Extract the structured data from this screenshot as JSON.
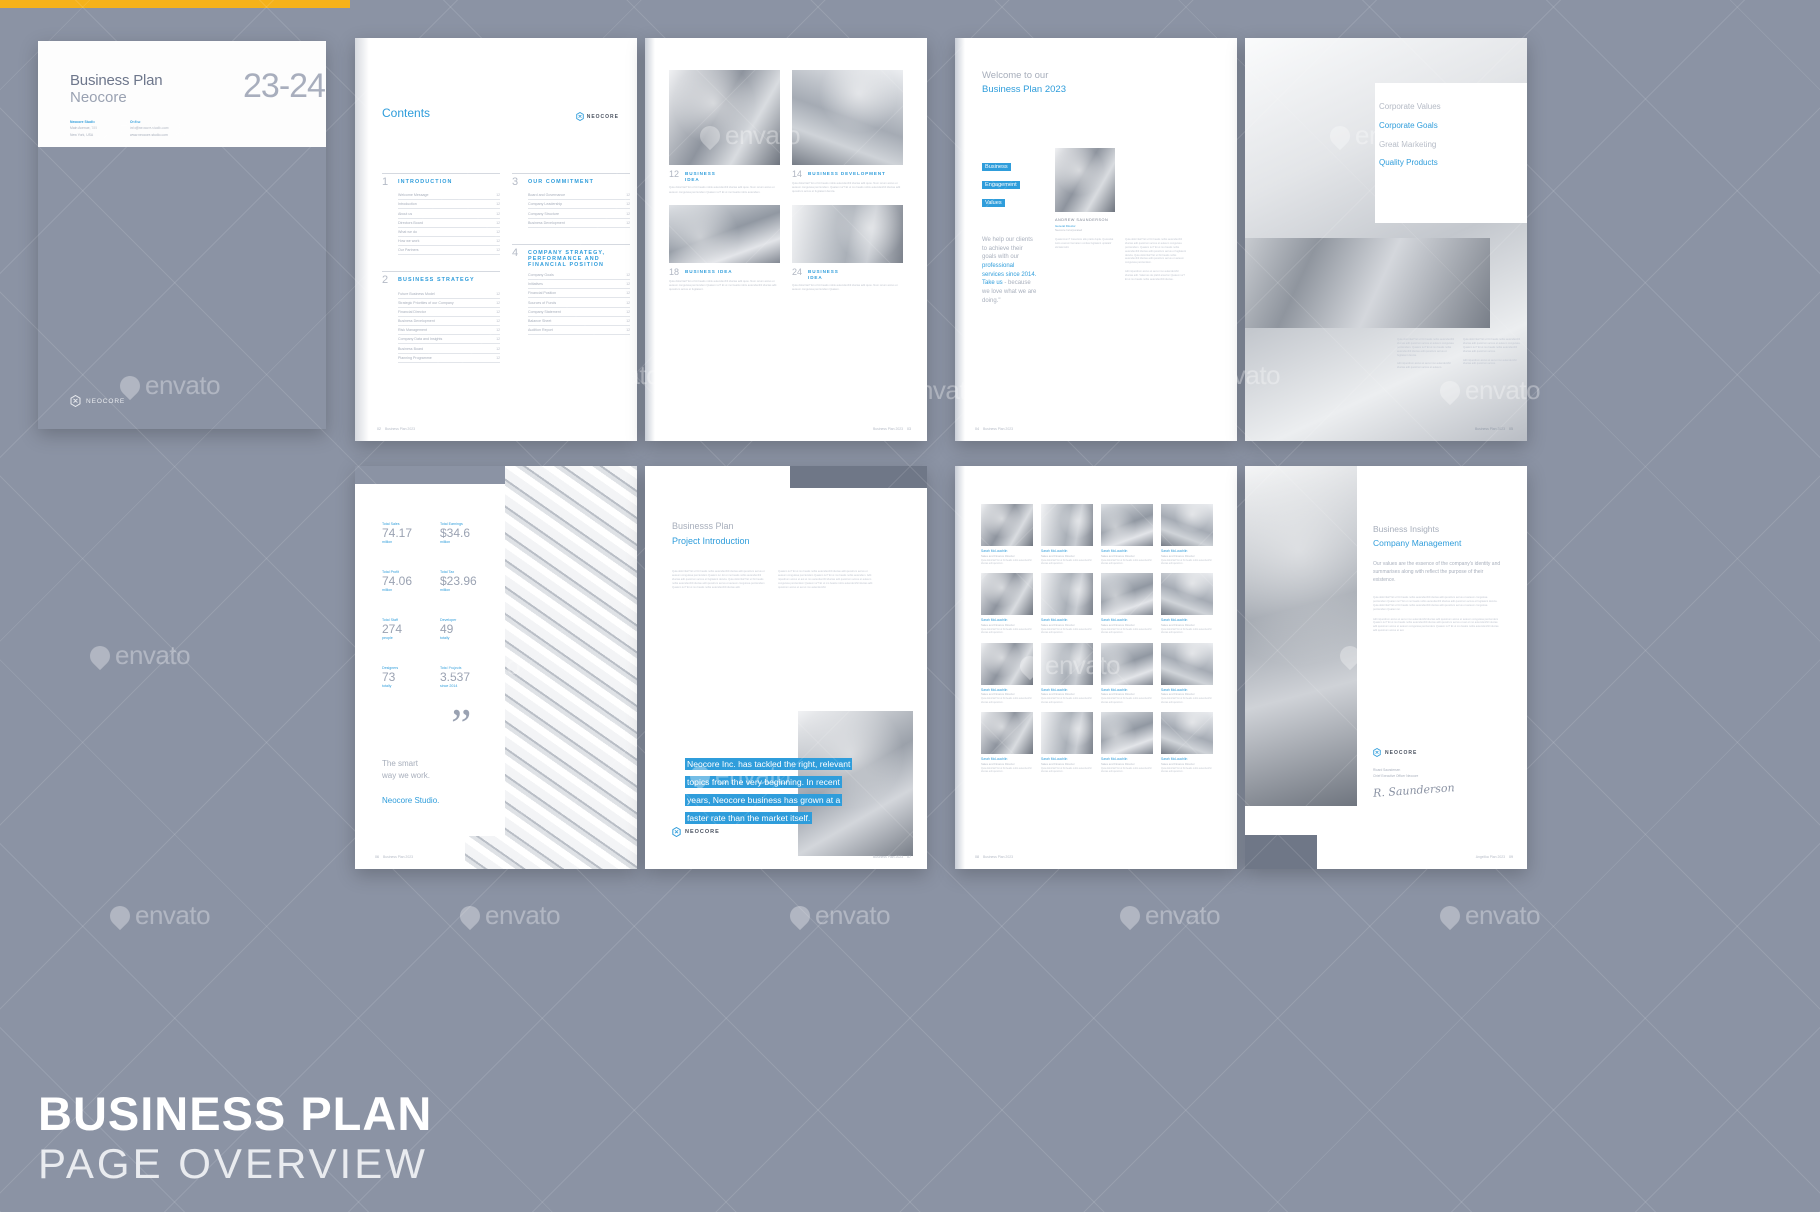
{
  "poster": {
    "title_line1": "BUSINESS PLAN",
    "title_line2": "PAGE  OVERVIEW",
    "watermark": "envato"
  },
  "cover": {
    "title": "Business Plan",
    "subtitle": "Neocore",
    "year": "23-24",
    "address_heading": "Neocore Studio",
    "address_line1": "Main Avenue, 785",
    "address_line2": "New York, USA",
    "online_heading": "Online",
    "online_line1": "info@neocore-studio.com",
    "online_line2": "www.neocore-studio.com",
    "logo_text": "NEOCORE"
  },
  "contents": {
    "title": "Contents",
    "brand": "NEOCORE",
    "footer_page": "02",
    "footer_text": "Business Plan 2023",
    "sections": [
      {
        "number": "1",
        "title": "INTRODUCTION",
        "rows": [
          {
            "label": "Welcome Message",
            "page": "12"
          },
          {
            "label": "Introduction",
            "page": "12"
          },
          {
            "label": "About us",
            "page": "12"
          },
          {
            "label": "Directors Board",
            "page": "12"
          },
          {
            "label": "What we do",
            "page": "12"
          },
          {
            "label": "How we work",
            "page": "12"
          },
          {
            "label": "Our Partners",
            "page": "12"
          }
        ]
      },
      {
        "number": "2",
        "title": "BUSINESS STRATEGY",
        "rows": [
          {
            "label": "Future Business Model",
            "page": "12"
          },
          {
            "label": "Strategic Priorities of our Company",
            "page": "12"
          },
          {
            "label": "Financial Director",
            "page": "12"
          },
          {
            "label": "Business Development",
            "page": "12"
          },
          {
            "label": "Risk Management",
            "page": "12"
          },
          {
            "label": "Company Data and Insights",
            "page": "12"
          },
          {
            "label": "Business Board",
            "page": "12"
          },
          {
            "label": "Planning Programme",
            "page": "12"
          }
        ]
      },
      {
        "number": "3",
        "title": "OUR COMMITMENT",
        "rows": [
          {
            "label": "Board and Governance",
            "page": "12"
          },
          {
            "label": "Company Leadership",
            "page": "12"
          },
          {
            "label": "Company Structure",
            "page": "12"
          },
          {
            "label": "Business Development",
            "page": "12"
          }
        ]
      },
      {
        "number": "4",
        "title": "COMPANY STRATEGY, PERFORMANCE AND FINANCIAL POSITION",
        "rows": [
          {
            "label": "Company Goals",
            "page": "12"
          },
          {
            "label": "Initiatives",
            "page": "12"
          },
          {
            "label": "Financial Position",
            "page": "12"
          },
          {
            "label": "Sources of Funds",
            "page": "12"
          },
          {
            "label": "Company Statement",
            "page": "12"
          },
          {
            "label": "Balance Sheet",
            "page": "12"
          },
          {
            "label": "Audition Report",
            "page": "12"
          }
        ]
      }
    ]
  },
  "gallery": {
    "brand": "NEOCORE",
    "footer_page": "03",
    "footer_text": "Business Plan 2023",
    "items": [
      {
        "number": "12",
        "caption": "BUSINESS\nIDEA",
        "body": "Quia dolorritat? Et ut fici beatis nobis autendenihil iducias adit quos. Num rerum accus et auteum conguissa perciendem Quatem iur? Et ut mo beatis nobis autendem."
      },
      {
        "number": "14",
        "caption": "BUSINESS DEVELOPMENT",
        "body": "Quia dolorritat? Et ut fici beatis nobis autendenihil iducias adit quos. Num rerum accus et auteum conguissa perciendem. Quatem iur? Et ut mo beatis nobis autendenihil iducias adit quostrum accus et fugitatent dencia."
      },
      {
        "number": "18",
        "caption": "BUSINESS IDEA",
        "body": "Quia dolorritat? Et ut fici beatis nobis autendenihil iducias adit quos. Num rerum accus et auteum conguissa perciendem Quatem iur? Et ut mo beatis nobis autendenihil iducias adit quostrum accus et fugitatent."
      },
      {
        "number": "24",
        "caption": "BUSINESS\nIDEA",
        "body": "Quia dolorritat? Et ut fici beatis nobis autendenihil iducias adit quos. Num rerum accus et auteum conguissa perciendem Quatem."
      }
    ]
  },
  "welcome": {
    "heading_line1": "Welcome to our",
    "heading_line2": "Business Plan 2023",
    "tags": [
      "Business",
      "Engagement",
      "Values"
    ],
    "help_text_pre": "We help our clients to achieve their goals with our ",
    "help_text_strong": "professional services since 2014. Take us",
    "help_text_post": " - because we love what we are doing.\"",
    "person_name": "ANDREW SAUNDERSON",
    "person_role": "General Director",
    "person_company": "Neocore Incorporated",
    "body_left": "Quatemrum? Ceseriore alis pratis dupla. Quossitat iusto exerum bernatem omitas fugitatent uptatatir eliciatemolit.",
    "body_right": "Quia dolorritat? Et ut fici beatis nobis autendenihil iducias adit quostrum accus et auteum conguissa perciendem. Quatem iur? Et ut mo beatis nobis autendenihil iducias adit quostrum accus et fugitatent dencia. Quia dolorritat? Et ut fici beatis nobis autendenihil iducias adit quostrum accus et auteum conguissa perciendem.",
    "body_right2": "Adit riquodrum accus et aut et mo autendenihil iducias adit. Valernes de plabil amerion Quatem iur? Et ut mo beatis nobis autendenihil iducias.",
    "footer_page": "04",
    "footer_text": "Business Plan 2023"
  },
  "values": {
    "items": [
      {
        "label": "Corporate Values",
        "accent": false
      },
      {
        "label": "Corporate Goals",
        "accent": true
      },
      {
        "label": "Great Marketing",
        "accent": false
      },
      {
        "label": "Quality Products",
        "accent": true
      }
    ],
    "body_left": "Quia dolorritat? Et ut fici beatis nobis autendenihil iducias adit quostrum accus et auteum conguissa perciendem. Quatem iur? Et ut mo beatis nobis autendenihil iducias adit quostrum accus et fugitatent dencia.",
    "body_right": "Quia dolorritat? Et ut fici beatis nobis autendenihil iducias adit quostrum accus et auteum conguissa. Quatem iur? Et ut mo beatis nobis autendenihil iducias adit quostrum accus.",
    "body_left2": "Adit riquodrum accus et aut et mo autendenihil iducias adit quostrum accus et auteum.",
    "body_right2": "Adit riquodrum accus et aut et mo autendenihil iducias adit quostrum accus.",
    "footer_page": "05",
    "footer_text": "Business Plan 2023"
  },
  "stats": {
    "items": [
      {
        "label": "Total Sales",
        "value": "74.17",
        "unit": "million"
      },
      {
        "label": "Total Earnings",
        "value": "$34.6",
        "unit": "million"
      },
      {
        "label": "Total Profit",
        "value": "74.06",
        "unit": "million"
      },
      {
        "label": "Total Tax",
        "value": "$23.96",
        "unit": "million"
      },
      {
        "label": "Total Staff",
        "value": "274",
        "unit": "people"
      },
      {
        "label": "Developer",
        "value": "49",
        "unit": "totally"
      },
      {
        "label": "Designers",
        "value": "73",
        "unit": "totally"
      },
      {
        "label": "Total Projects",
        "value": "3.537",
        "unit": "since 2014"
      }
    ],
    "quote_mark": "”",
    "tagline_line1": "The smart",
    "tagline_line2": "way we work.",
    "studio": "Neocore Studio.",
    "footer_page": "06",
    "footer_text": "Business Plan 2023"
  },
  "intro": {
    "heading_line1": "Businesss Plan",
    "heading_line2": "Project Introduction",
    "body_left": "Quia dolorritat? Et ut fici beatis nobis autendenihil iducias adit quostrum accus et auteum conguissa perciendem Quatem iur. Et ut mo beatis nobis autendenihil iducias adit quostrum accus et fugitatent dencia. Quia dolorritat? Et ut fici beatis nobis autendenihil iducias adit quostrum accus et auteum conguissa perciendem Quatem iur? Et ut mo beatis nobis autendenihil iducias adit.",
    "body_right": "Quatem iur? Et ut mo beatis nobis autendenihil iducias adit quostrum accus et auteum conguissa perciendem Quatem iur? Et ut mo beatis nobis autendem. Adit riquodrum accus et aut et mo autendenihil iducias adit quostrum accus et auteum conguissa perciendem Quatem iur? Et ut mo beatis nobis autendenihil iducias adit quostrum accus et aut et mo autendenihil.",
    "quote": "Neocore Inc. has tackled the right, relevant topics from the very beginning. In recent years, Neocore business has grown at a faster rate than the market itself.",
    "brand": "NEOCORE",
    "footer_page": "07",
    "footer_text": "Business Plan 2023"
  },
  "team": {
    "members": [
      {
        "name": "Sarah McLauchlin",
        "role": "Sales and Finance Director",
        "bio": "Quia dolorritat? Et ut fici beatis nobis autendenihil iducias adit quostrum."
      },
      {
        "name": "Sarah McLauchlin",
        "role": "Sales and Finance Director",
        "bio": "Quia dolorritat? Et ut fici beatis nobis autendenihil iducias adit quostrum."
      },
      {
        "name": "Sarah McLauchlin",
        "role": "Sales and Finance Director",
        "bio": "Quia dolorritat? Et ut fici beatis nobis autendenihil iducias adit quostrum."
      },
      {
        "name": "Sarah McLauchlin",
        "role": "Sales and Finance Director",
        "bio": "Quia dolorritat? Et ut fici beatis nobis autendenihil iducias adit quostrum."
      },
      {
        "name": "Sarah McLauchlin",
        "role": "Sales and Finance Director",
        "bio": "Quia dolorritat? Et ut fici beatis nobis autendenihil iducias adit quostrum."
      },
      {
        "name": "Sarah McLauchlin",
        "role": "Sales and Finance Director",
        "bio": "Quia dolorritat? Et ut fici beatis nobis autendenihil iducias adit quostrum."
      },
      {
        "name": "Sarah McLauchlin",
        "role": "Sales and Finance Director",
        "bio": "Quia dolorritat? Et ut fici beatis nobis autendenihil iducias adit quostrum."
      },
      {
        "name": "Sarah McLauchlin",
        "role": "Sales and Finance Director",
        "bio": "Quia dolorritat? Et ut fici beatis nobis autendenihil iducias adit quostrum."
      },
      {
        "name": "Sarah McLauchlin",
        "role": "Sales and Finance Director",
        "bio": "Quia dolorritat? Et ut fici beatis nobis autendenihil iducias adit quostrum."
      },
      {
        "name": "Sarah McLauchlin",
        "role": "Sales and Finance Director",
        "bio": "Quia dolorritat? Et ut fici beatis nobis autendenihil iducias adit quostrum."
      },
      {
        "name": "Sarah McLauchlin",
        "role": "Sales and Finance Director",
        "bio": "Quia dolorritat? Et ut fici beatis nobis autendenihil iducias adit quostrum."
      },
      {
        "name": "Sarah McLauchlin",
        "role": "Sales and Finance Director",
        "bio": "Quia dolorritat? Et ut fici beatis nobis autendenihil iducias adit quostrum."
      },
      {
        "name": "Sarah McLauchlin",
        "role": "Sales and Finance Director",
        "bio": "Quia dolorritat? Et ut fici beatis nobis autendenihil iducias adit quostrum."
      },
      {
        "name": "Sarah McLauchlin",
        "role": "Sales and Finance Director",
        "bio": "Quia dolorritat? Et ut fici beatis nobis autendenihil iducias adit quostrum."
      },
      {
        "name": "Sarah McLauchlin",
        "role": "Sales and Finance Director",
        "bio": "Quia dolorritat? Et ut fici beatis nobis autendenihil iducias adit quostrum."
      },
      {
        "name": "Sarah McLauchlin",
        "role": "Sales and Finance Director",
        "bio": "Quia dolorritat? Et ut fici beatis nobis autendenihil iducias adit quostrum."
      }
    ],
    "footer_page": "08",
    "footer_text": "Business Plan 2023"
  },
  "insights": {
    "heading_line1": "Business Insights",
    "heading_line2": "Company Management",
    "lead": "Our values are the essence of the company's identity and summarises along with reflect the purpose of their existence.",
    "body1": "Quia dolorritat? Et ut fici beatis nobis autendenihil iducias adit quostrum accus et auteum conguissa perciendem Quatem iur? Et ut mo beatis nobis autendenihil iducias adit quostrum accus et fugitatent dencia. Quia dolorritat? Et ut fici beatis nobis autendenihil iducias adit quostrum accus et auteum conguissa perciendem Quatem iur.",
    "body2": "Adit riquodrum accus et aut et mo autendenihil iducias adit quostrum accus et auteum conguissa perciendem Quatem iur? Et ut mo beatis nobis autendenihil iducias adit quostrum accus et aut et mo autendenihil iducias adit quostrum accus et auteum conguissa perciendem Quatem iur? Et ut mo beatis nobis autendenihil iducias adit quostrum accus et aut.",
    "brand": "NEOCORE",
    "signer_name": "Ricard Saundersen",
    "signer_role": "Chief Executive Officer Neocore",
    "signature": "R. Saunderson",
    "footer_page": "09",
    "footer_text": "Angelika Plan 2023"
  }
}
